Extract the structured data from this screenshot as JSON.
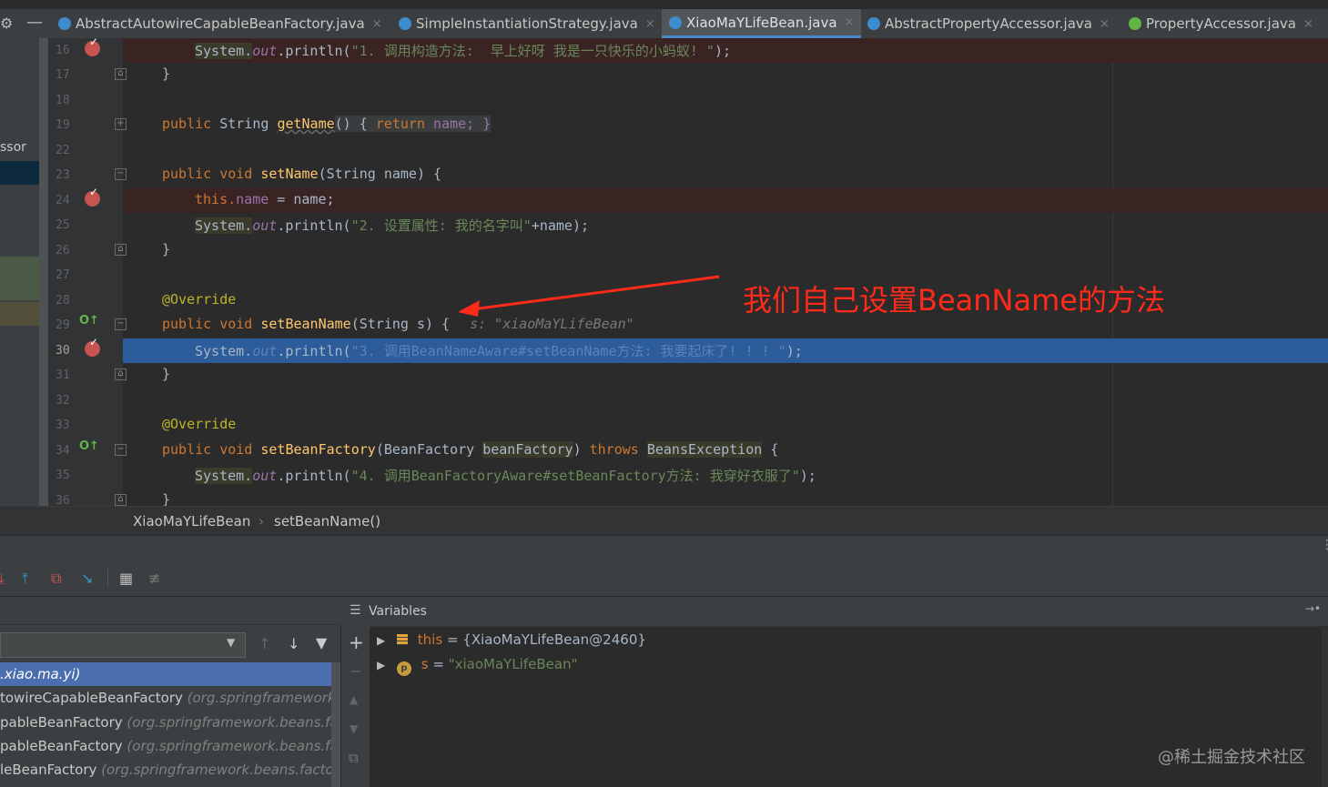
{
  "tabs": [
    {
      "label": "AbstractAutowireCapableBeanFactory.java",
      "icon": "class-icon",
      "active": false
    },
    {
      "label": "SimpleInstantiationStrategy.java",
      "icon": "class-icon",
      "active": false
    },
    {
      "label": "XiaoMaYLifeBean.java",
      "icon": "class-icon",
      "active": true
    },
    {
      "label": "AbstractPropertyAccessor.java",
      "icon": "class-icon",
      "active": false
    },
    {
      "label": "PropertyAccessor.java",
      "icon": "interface-icon",
      "active": false
    }
  ],
  "tab_close": "×",
  "left_panel": {
    "partial_label": "ssor"
  },
  "gutter": {
    "line_numbers": [
      "16",
      "17",
      "18",
      "19",
      "22",
      "23",
      "24",
      "25",
      "26",
      "27",
      "28",
      "29",
      "30",
      "31",
      "32",
      "33",
      "34",
      "35",
      "36"
    ]
  },
  "code": {
    "l16": {
      "sys": "System.",
      "out": "out",
      ".println(": ".println(",
      "str": "\"1. 调用构造方法:  早上好呀 我是一只快乐的小蚂蚁! \"",
      "end": ");"
    },
    "l17": "}",
    "l19": {
      "kw": "public",
      "type": " String ",
      "fn": "getName",
      "rest": "() { ",
      "ret": "return",
      " name": " name; }"
    },
    "l23": {
      "kw": "public void ",
      "fn": "setName",
      "rest": "(String name) {"
    },
    "l24": {
      "this": "this.",
      "name": "name",
      " rest": " = name;"
    },
    "l25": {
      "sys": "System.",
      "out": "out",
      ".println(": ".println(",
      "str": "\"2. 设置属性: 我的名字叫\"",
      "end": "+name);"
    },
    "l26": "}",
    "l28": "@Override",
    "l29": {
      "kw": "public void ",
      "fn": "setBeanName",
      "rest": "(String s) {",
      "hint": "s: \"xiaoMaYLifeBean\""
    },
    "l30": {
      "sys": "System.",
      "out": "out",
      ".println(": ".println(",
      "str": "\"3. 调用BeanNameAware#setBeanName方法: 我要起床了! ! ! \"",
      "end": ");"
    },
    "l31": "}",
    "l33": "@Override",
    "l34": {
      "kw": "public void ",
      "fn": "setBeanFactory",
      "rest": "(BeanFactory ",
      "param": "beanFactory",
      ") ": ") ",
      "throws": "throws ",
      "exc": "BeansException",
      " {": " {"
    },
    "l35": {
      "sys": "System.",
      "out": "out",
      ".println(": ".println(",
      "str": "\"4. 调用BeanFactoryAware#setBeanFactory方法: 我穿好衣服了\"",
      "end": ");"
    },
    "l36": "}"
  },
  "annotation": "我们自己设置BeanName的方法",
  "breadcrumb": {
    "class": "XiaoMaYLifeBean",
    "sep": "›",
    "method": "setBeanName()"
  },
  "debug_toolbar": [
    "step-into-icon",
    "step-out-icon",
    "drop-frame-icon",
    "run-to-cursor-icon",
    "evaluate-icon",
    "trace-icon"
  ],
  "frames": [
    {
      "name": ".xiao.ma.yi)",
      "pkg": "",
      "selected": true
    },
    {
      "name": "towireCapableBeanFactory ",
      "pkg": "(org.springframework.be",
      "selected": false
    },
    {
      "name": "pableBeanFactory ",
      "pkg": "(org.springframework.beans.facto",
      "selected": false
    },
    {
      "name": "pableBeanFactory ",
      "pkg": "(org.springframework.beans.facto",
      "selected": false
    },
    {
      "name": "leBeanFactory ",
      "pkg": "(org.springframework.beans.factory.",
      "selected": false
    }
  ],
  "variables": {
    "header": "Variables",
    "items": [
      {
        "name": "this",
        "eq": " = ",
        "value": "{XiaoMaYLifeBean@2460}",
        "icon": "field-icon"
      },
      {
        "name": "s",
        "eq": " = ",
        "value": "\"xiaoMaYLifeBean\"",
        "icon": "parameter-icon"
      }
    ]
  },
  "watermark": "@稀土掘金技术社区",
  "colors": {
    "breakpoint": "#c75450",
    "selection": "#2d5c9b",
    "annotation": "#ff2a1a"
  }
}
